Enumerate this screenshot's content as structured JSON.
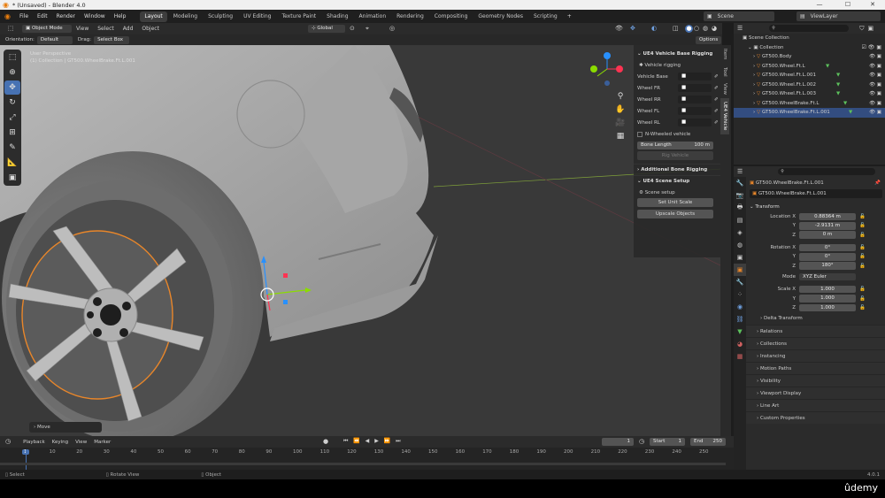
{
  "window": {
    "title": "* (Unsaved) - Blender 4.0",
    "minimize": "—",
    "maximize": "☐",
    "close": "✕"
  },
  "menu": {
    "items": [
      "File",
      "Edit",
      "Render",
      "Window",
      "Help"
    ],
    "workspaces": [
      "Layout",
      "Modeling",
      "Sculpting",
      "UV Editing",
      "Texture Paint",
      "Shading",
      "Animation",
      "Rendering",
      "Compositing",
      "Geometry Nodes",
      "Scripting"
    ],
    "scene": "Scene",
    "view_layer": "ViewLayer"
  },
  "vp_header": {
    "mode": "Object Mode",
    "view": "View",
    "select": "Select",
    "add": "Add",
    "object": "Object",
    "transform_orientation": "Global"
  },
  "tool_header": {
    "orientation_label": "Orientation:",
    "orientation_value": "Default",
    "drag_label": "Drag:",
    "drag_value": "Select Box",
    "options": "Options"
  },
  "viewport": {
    "perspective": "User Perspective",
    "collection": "(1) Collection | GT500.WheelBrake.Ft.L.001",
    "operator": "Move",
    "gizmo": {
      "x": "X",
      "y": "Y",
      "z": "Z"
    }
  },
  "npanel": {
    "rigging_title": "UE4 Vehicle Base Rigging",
    "vehicle_rigging": "Vehicle rigging",
    "fields": [
      "Vehicle Base",
      "Wheel FR",
      "Wheel RR",
      "Wheel FL",
      "Wheel RL"
    ],
    "n_wheeled": "N-Wheeled vehicle",
    "bone_length_label": "Bone Length",
    "bone_length_value": "100 m",
    "rig_vehicle": "Rig Vehicle",
    "additional": "Additional Bone Rigging",
    "scene_setup_title": "UE4 Scene Setup",
    "scene_setup": "Scene setup",
    "set_unit_scale": "Set Unit Scale",
    "upscale": "Upscale Objects"
  },
  "ntabs": [
    "Item",
    "Tool",
    "View",
    "UE4 Vehicle"
  ],
  "outliner": {
    "root": "Scene Collection",
    "collection": "Collection",
    "items": [
      "GT500.Body",
      "GT500.Wheel.Ft.L",
      "GT500.Wheel.Ft.L.001",
      "GT500.Wheel.Ft.L.002",
      "GT500.Wheel.Ft.L.003",
      "GT500.WheelBrake.Ft.L",
      "GT500.WheelBrake.Ft.L.001"
    ]
  },
  "properties": {
    "object_name": "GT500.WheelBrake.Ft.L.001",
    "data_name": "GT500.WheelBrake.Ft.L.001",
    "transform": "Transform",
    "location": {
      "label": "Location X",
      "x": "0.88364 m",
      "y": "-2.9131 m",
      "z": "0 m"
    },
    "rotation": {
      "label": "Rotation X",
      "x": "0°",
      "y": "0°",
      "z": "180°"
    },
    "mode_label": "Mode",
    "mode_value": "XYZ Euler",
    "scale": {
      "label": "Scale X",
      "x": "1.000",
      "y": "1.000",
      "z": "1.000"
    },
    "axis": {
      "y": "Y",
      "z": "Z"
    },
    "delta": "Delta Transform",
    "sections": [
      "Relations",
      "Collections",
      "Instancing",
      "Motion Paths",
      "Visibility",
      "Viewport Display",
      "Line Art",
      "Custom Properties"
    ]
  },
  "timeline": {
    "playback": "Playback",
    "keying": "Keying",
    "view": "View",
    "marker": "Marker",
    "current_frame": "1",
    "start_label": "Start",
    "start": "1",
    "end_label": "End",
    "end": "250",
    "ticks": [
      "1",
      "10",
      "20",
      "30",
      "40",
      "50",
      "60",
      "70",
      "80",
      "90",
      "100",
      "110",
      "120",
      "130",
      "140",
      "150",
      "160",
      "170",
      "180",
      "190",
      "200",
      "210",
      "220",
      "230",
      "240",
      "250"
    ]
  },
  "status": {
    "select": "Select",
    "rotate": "Rotate View",
    "object": "Object",
    "version": "4.0.1",
    "watermark": "ûdemy"
  },
  "colors": {
    "active_blue": "#4772b3",
    "x_axis": "#ff3352",
    "y_axis": "#8bdc00",
    "z_axis": "#2890ff",
    "selected_outline": "#e8862a"
  }
}
